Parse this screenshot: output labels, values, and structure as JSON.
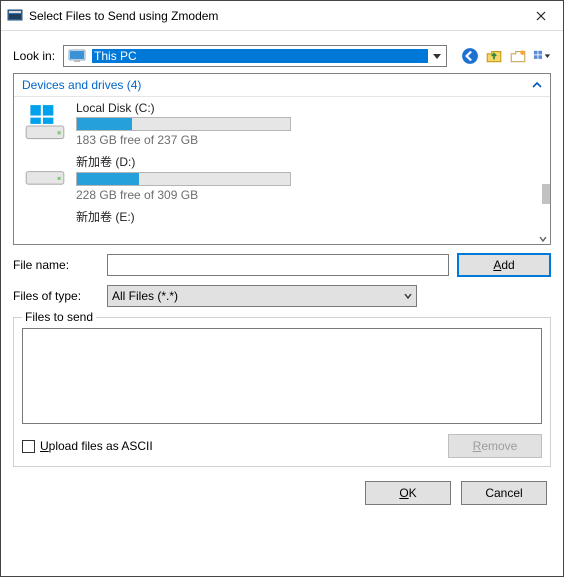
{
  "window": {
    "title": "Select Files to Send using Zmodem"
  },
  "lookin": {
    "label": "Look in:",
    "value": "This PC"
  },
  "section": {
    "title_prefix": "Devices and drives (",
    "count": "4",
    "title_suffix": ")"
  },
  "drives": [
    {
      "name": "Local Disk (C:)",
      "free": "183 GB free of 237 GB",
      "fillpct": 26,
      "kind": "system"
    },
    {
      "name": "新加卷 (D:)",
      "free": "228 GB free of 309 GB",
      "fillpct": 29,
      "kind": "data"
    },
    {
      "name": "新加卷 (E:)",
      "free": "",
      "fillpct": 0,
      "kind": "data"
    }
  ],
  "filename": {
    "label": "File name:",
    "value": ""
  },
  "add_btn": {
    "prefix": "",
    "accel": "A",
    "suffix": "dd"
  },
  "filetype": {
    "label": "Files of type:",
    "value": "All Files (*.*)"
  },
  "group": {
    "legend": "Files to send"
  },
  "ascii_chk": {
    "prefix": "",
    "accel": "U",
    "suffix": "pload files as ASCII",
    "checked": false
  },
  "remove_btn": {
    "prefix": "",
    "accel": "R",
    "suffix": "emove"
  },
  "ok_btn": {
    "prefix": "",
    "accel": "O",
    "suffix": "K"
  },
  "cancel_btn": {
    "label": "Cancel"
  }
}
